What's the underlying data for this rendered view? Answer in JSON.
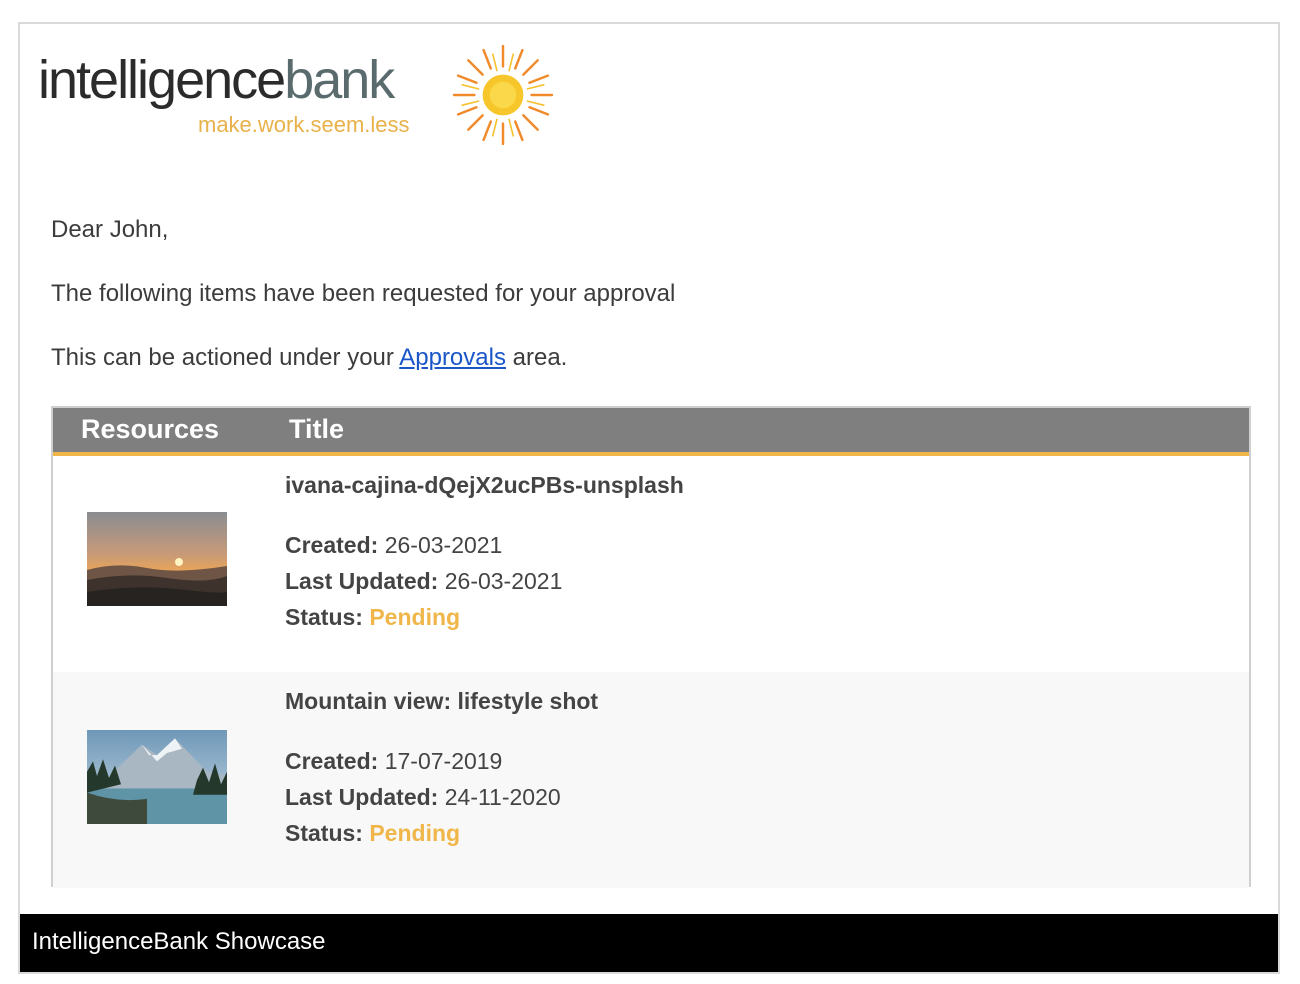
{
  "logo": {
    "word_part1": "intelligence",
    "word_part2": "bank",
    "tagline": "make.work.seem.less",
    "icon": "sun-icon"
  },
  "email": {
    "greeting": "Dear John,",
    "intro": "The following items have been requested for your approval",
    "action_prefix": "This can be actioned under your ",
    "action_link": "Approvals",
    "action_suffix": " area."
  },
  "table": {
    "headers": [
      "Resources",
      "Title"
    ],
    "rows": [
      {
        "title": "ivana-cajina-dQejX2ucPBs-unsplash",
        "created_label": "Created:",
        "created": "26-03-2021",
        "updated_label": "Last Updated:",
        "updated": "26-03-2021",
        "status_label": "Status:",
        "status": "Pending",
        "thumbnail": "sunset-mountains-image"
      },
      {
        "title": "Mountain view: lifestyle shot",
        "created_label": "Created:",
        "created": "17-07-2019",
        "updated_label": "Last Updated:",
        "updated": "24-11-2020",
        "status_label": "Status:",
        "status": "Pending",
        "thumbnail": "mountain-lake-image"
      }
    ]
  },
  "footer": {
    "text": "IntelligenceBank Showcase"
  },
  "colors": {
    "accent": "#f0b64a",
    "header_bg": "#7f7f7f",
    "link": "#1a56c8",
    "footer_bg": "#000000"
  }
}
